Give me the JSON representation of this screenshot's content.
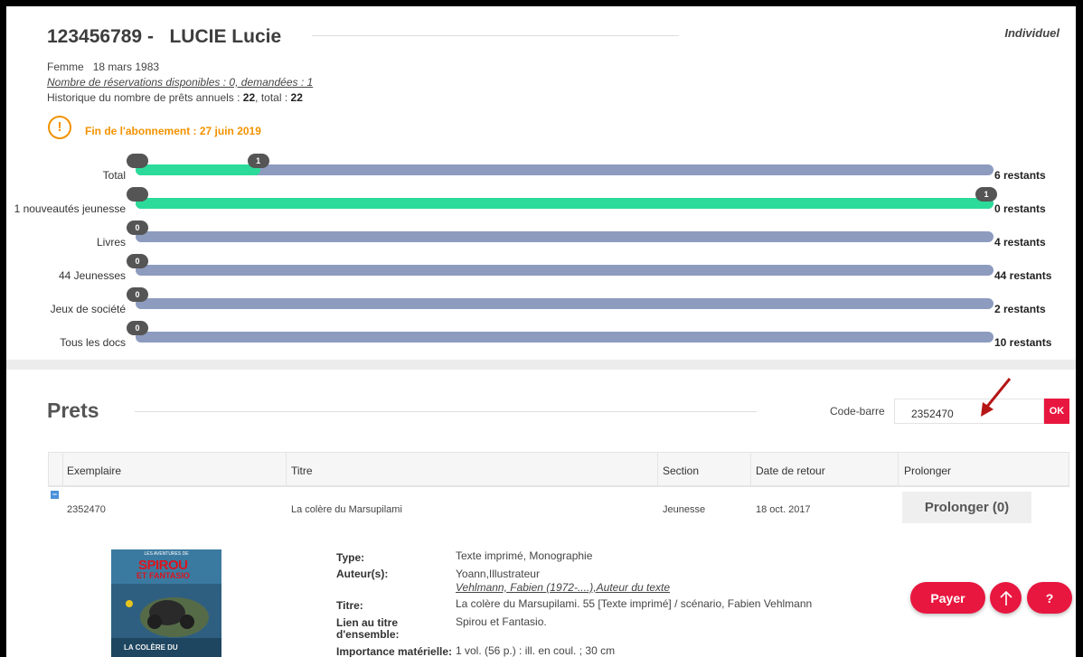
{
  "patron": {
    "id": "123456789 -",
    "name": "LUCIE Lucie",
    "type": "Individuel",
    "gender": "Femme",
    "birth_date": "18 mars 1983",
    "reservations": "Nombre de réservations disponibles : 0, demandées : 1",
    "history_prefix": "Historique du nombre de prêts annuels : ",
    "history_annual": "22",
    "history_mid": ", total : ",
    "history_total": "22",
    "warning_icon": "!",
    "subscription_end": "Fin de l'abonnement : 27 juin 2019"
  },
  "quotas": [
    {
      "label": "Total",
      "start_bubble": "",
      "count": "1",
      "fill_fraction": 0.145,
      "remaining": "6 restants"
    },
    {
      "label": "1 nouveautés jeunesse",
      "start_bubble": "",
      "count": "1",
      "fill_fraction": 1.0,
      "remaining": "0 restants"
    },
    {
      "label": "Livres",
      "count": "0",
      "fill_fraction": 0,
      "remaining": "4 restants"
    },
    {
      "label": "44 Jeunesses",
      "count": "0",
      "fill_fraction": 0,
      "remaining": "44 restants"
    },
    {
      "label": "Jeux de société",
      "count": "0",
      "fill_fraction": 0,
      "remaining": "2 restants"
    },
    {
      "label": "Tous les docs",
      "count": "0",
      "fill_fraction": 0,
      "remaining": "10 restants"
    }
  ],
  "prets": {
    "title": "Prets",
    "barcode_label": "Code-barre",
    "barcode_value": "2352470",
    "ok_label": "OK",
    "columns": [
      "Exemplaire",
      "Titre",
      "Section",
      "Date de retour",
      "Prolonger"
    ],
    "rows": [
      {
        "expand_icon": "−",
        "exemplaire": "2352470",
        "titre": "La colère du Marsupilami",
        "section": "Jeunesse",
        "date_retour": "18 oct. 2017",
        "prolonger_label": "Prolonger (0)"
      }
    ]
  },
  "details": {
    "cover_top": "LES AVENTURES DE",
    "cover_brand1": "SPIROU",
    "cover_brand2": "ET FANTASIO",
    "cover_bottom": "LA COLÈRE DU",
    "type_label": "Type:",
    "type_value": "Texte imprimé, Monographie",
    "auteurs_label": "Auteur(s):",
    "auteur1": "Yoann,Illustrateur",
    "auteur2": "Vehlmann, Fabien (1972-....),Auteur du texte",
    "titre_label": "Titre:",
    "titre_value": "La colère du Marsupilami. 55 [Texte imprimé] / scénario, Fabien Vehlmann",
    "lien_label": "Lien au titre d'ensemble:",
    "lien_value": "Spirou et Fantasio.",
    "next_label": "Importance matérielle:",
    "next_value": "1 vol. (56 p.) : ill. en coul. ; 30 cm"
  },
  "actions": {
    "pay_label": "Payer",
    "up_icon": "arrow-up-icon",
    "help_label": "?"
  },
  "colors": {
    "accent": "#e8173f",
    "progress": "#2cdb9a",
    "track": "#8d9bbf",
    "warning": "#f39200"
  }
}
